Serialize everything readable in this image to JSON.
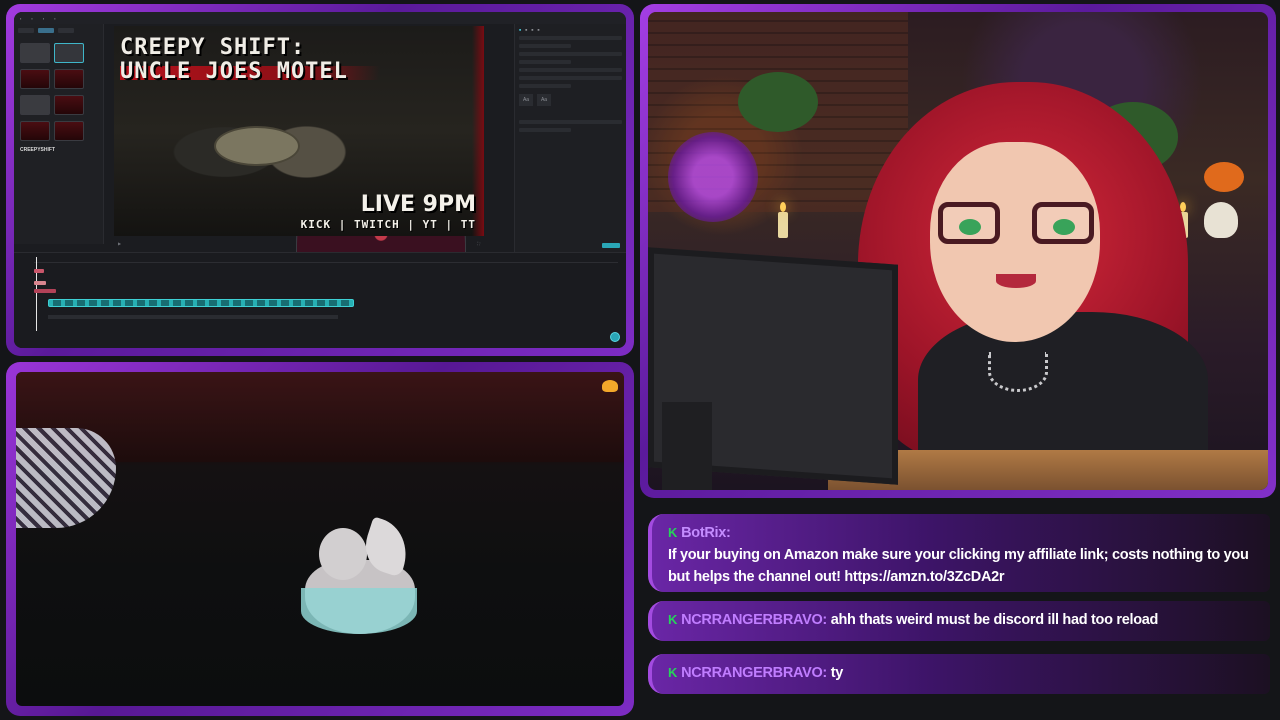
{
  "editor": {
    "preview_title_line1": "CREEPY SHIFT:",
    "preview_title_line2": "UNCLE JOES MOTEL",
    "preview_live": "LIVE 9PM",
    "preview_platforms": "KICK | TWITCH | YT | TT",
    "bin_label": "CREEPYSHIFT"
  },
  "chat": {
    "messages": [
      {
        "badge": "K",
        "user": "BotRix:",
        "text": "If your buying on Amazon make sure your clicking my affiliate link; costs nothing to you but helps the channel out! https://amzn.to/3ZcDA2r"
      },
      {
        "badge": "K",
        "user": "NCRRANGERBRAVO:",
        "text": "ahh thats weird must be discord ill had too reload"
      },
      {
        "badge": "K",
        "user": "NCRRANGERBRAVO:",
        "text": "ty"
      }
    ]
  },
  "colors": {
    "frame_purple": "#7d2cc4",
    "chat_badge": "#27d35a",
    "chat_user": "#c48cff"
  }
}
